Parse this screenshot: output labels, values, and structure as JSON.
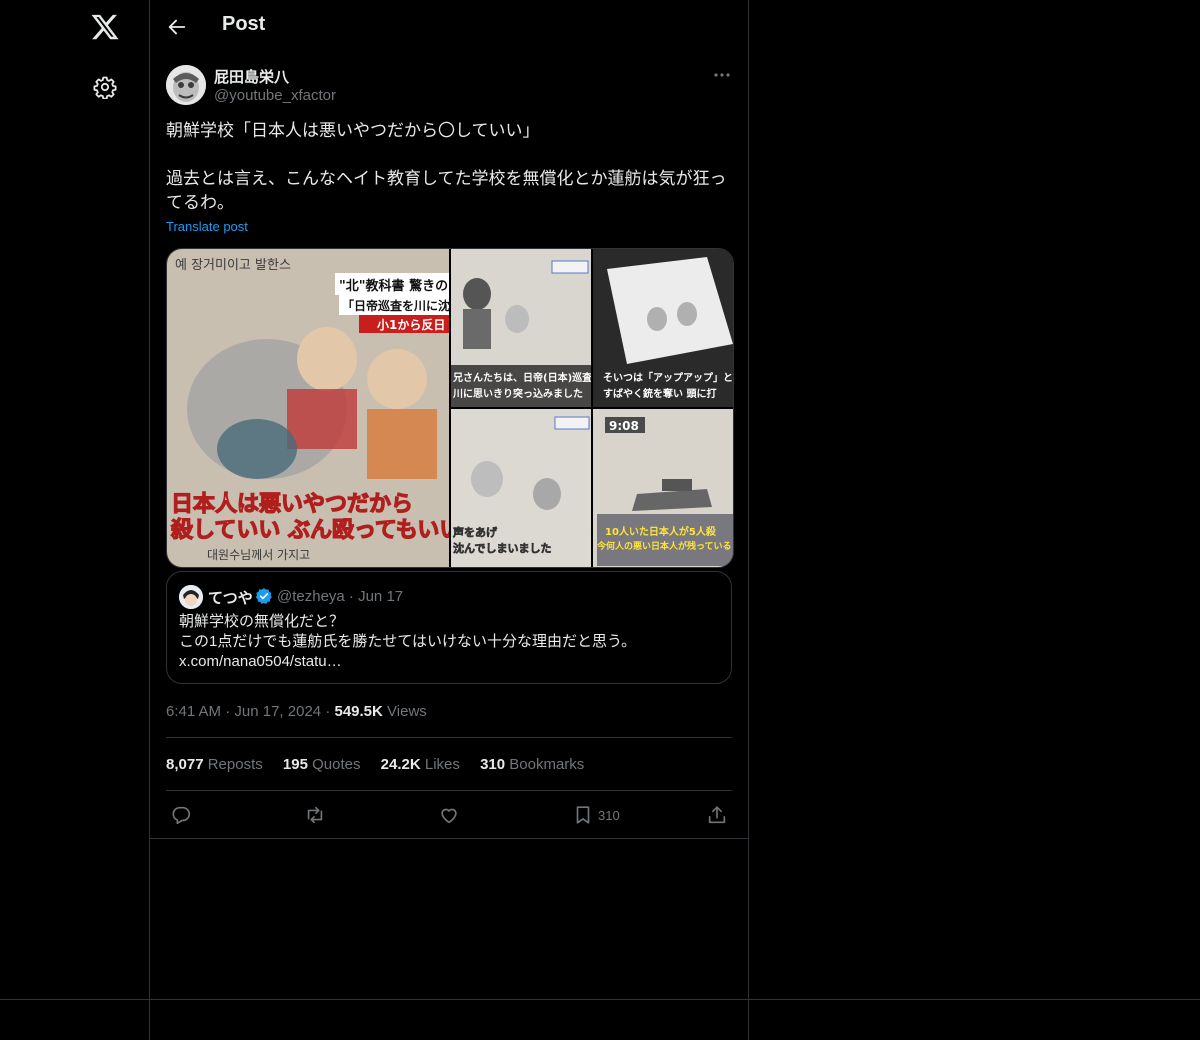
{
  "header": {
    "title": "Post"
  },
  "rail": {
    "logo_icon": "x-logo-icon",
    "settings_icon": "gear-icon"
  },
  "author": {
    "name": "屁田島栄八",
    "handle": "@youtube_xfactor"
  },
  "post": {
    "text": "朝鮮学校「日本人は悪いやつだから〇していい」\n\n過去とは言え、こんなヘイト教育してた学校を無償化とか蓮舫は気が狂ってるわ。",
    "translate_label": "Translate post"
  },
  "media": {
    "panel1": {
      "top_caption_1": "\"北\"教科書 驚きの",
      "top_caption_2": "「日帝巡査を川に沈",
      "top_caption_3": "小1から反日",
      "korean_top": "예 장거미이고 발한스",
      "subtitle_1": "日本人は悪いやつだから",
      "subtitle_2": "殺していい ぶん殴ってもいい",
      "korean_bottom": "대원수님께서     가지고"
    },
    "panel2": {
      "caption_1": "兄さんたちは、日帝(日本)巡査",
      "caption_2": "川に思いきり突っ込みました"
    },
    "panel3": {
      "caption_1": "そいつは「アップアップ」と",
      "caption_2": "すばやく銃を奪い 頭に打"
    },
    "panel4": {
      "caption_1": "声をあげ",
      "caption_2": "沈んでしまいました"
    },
    "panel5": {
      "time": "9:08",
      "caption_1": "10人いた日本人が5人殺",
      "caption_2": "今何人の悪い日本人が残っている"
    }
  },
  "quote": {
    "name": "てつや",
    "handle": "@tezheya",
    "date": "Jun 17",
    "meta": "@tezheya · Jun 17",
    "text": "朝鮮学校の無償化だと？\nこの1点だけでも蓮舫氏を勝たせてはいけない十分な理由だと思う。\nx.com/nana0504/statu…"
  },
  "meta": {
    "time": "6:41 AM",
    "date": "Jun 17, 2024",
    "views_count": "549.5K",
    "views_label": "Views",
    "dot": "·"
  },
  "stats": [
    {
      "count": "8,077",
      "label": "Reposts"
    },
    {
      "count": "195",
      "label": "Quotes"
    },
    {
      "count": "24.2K",
      "label": "Likes"
    },
    {
      "count": "310",
      "label": "Bookmarks"
    }
  ],
  "actions": {
    "reply": "reply-icon",
    "repost": "repost-icon",
    "like": "heart-icon",
    "bookmark": "bookmark-icon",
    "bookmark_count": "310",
    "share": "share-icon"
  },
  "colors": {
    "background": "#000000",
    "text": "#e7e9ea",
    "muted": "#71767b",
    "accent": "#1d9bf0",
    "border": "#2f3336"
  }
}
